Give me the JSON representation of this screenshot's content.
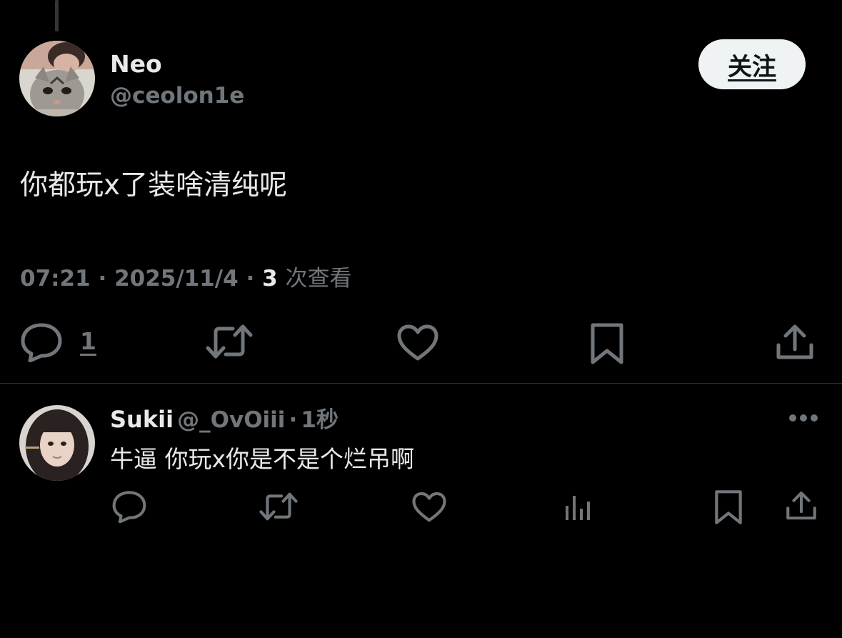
{
  "tweet": {
    "author_name": "Neo",
    "author_handle": "@ceolon1e",
    "follow_label": "关注",
    "text": "你都玩x了装啥清纯呢",
    "time": "07:21",
    "date": "2025/11/4",
    "separator": "·",
    "views_count": "3",
    "views_label": "次查看",
    "reply_count": "1",
    "icons": [
      "reply-icon",
      "retweet-icon",
      "like-icon",
      "bookmark-icon",
      "share-icon"
    ]
  },
  "reply": {
    "author_name": "Sukii",
    "author_handle": "@_OvOiii",
    "separator": "·",
    "time": "1秒",
    "text": "牛逼 你玩x你是不是个烂吊啊",
    "icons": [
      "reply-icon",
      "retweet-icon",
      "like-icon",
      "views-icon",
      "bookmark-icon",
      "share-icon",
      "more-icon"
    ]
  },
  "colors": {
    "background": "#000000",
    "text_primary": "#e7e9ea",
    "text_secondary": "#71767b",
    "button_bg": "#eff3f4",
    "divider": "#2f3336"
  }
}
